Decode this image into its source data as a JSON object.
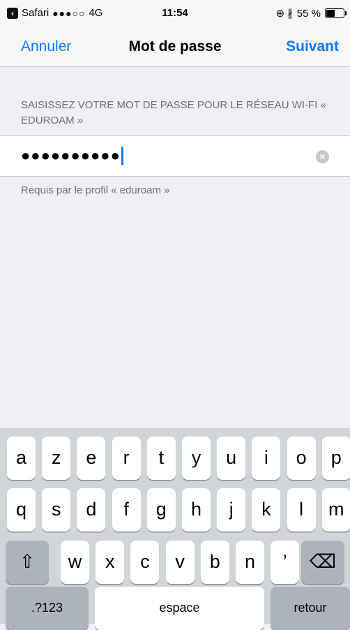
{
  "status_bar": {
    "back_app": "Safari",
    "signal_dots": "●●●○○",
    "network": "4G",
    "time": "11:54",
    "right_icons": "⊕ ∦",
    "battery": "55 %",
    "battery_level": 0.55
  },
  "nav": {
    "cancel": "Annuler",
    "title": "Mot de passe",
    "next": "Suivant"
  },
  "form": {
    "section_header": "SAISISSEZ VOTRE MOT DE PASSE POUR LE RÉSEAU WI-FI « EDUROAM »",
    "password_masked": "●●●●●●●●●●",
    "footer": "Requis par le profil « eduroam »"
  },
  "keyboard": {
    "row1": [
      "a",
      "z",
      "e",
      "r",
      "t",
      "y",
      "u",
      "i",
      "o",
      "p"
    ],
    "row2": [
      "q",
      "s",
      "d",
      "f",
      "g",
      "h",
      "j",
      "k",
      "l",
      "m"
    ],
    "row3": [
      "w",
      "x",
      "c",
      "v",
      "b",
      "n",
      "’"
    ],
    "shift": "⇧",
    "delete": "⌫",
    "numbers": ".?123",
    "space": "espace",
    "return": "retour"
  },
  "colors": {
    "accent": "#0a7aff",
    "background": "#efeff4",
    "keyboard": "#d1d4d9"
  }
}
